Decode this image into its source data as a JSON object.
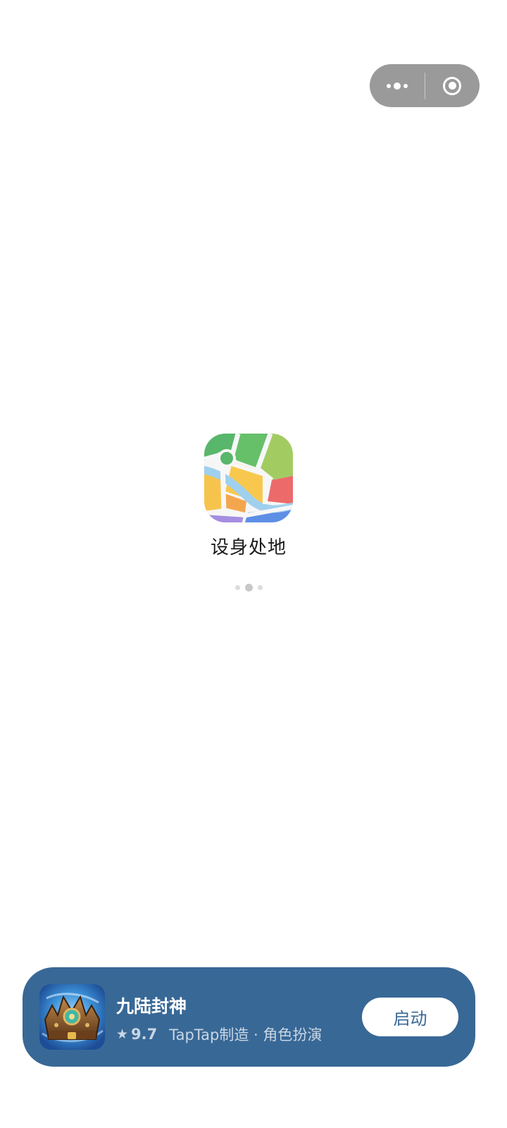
{
  "capsule": {
    "more_icon": "more-dots-icon",
    "close_icon": "close-circle-icon"
  },
  "splash": {
    "app_name": "设身处地",
    "logo_icon": "map-icon"
  },
  "banner": {
    "game_name": "九陆封神",
    "rating": "9.7",
    "meta": "TapTap制造 · 角色扮演",
    "launch_label": "启动",
    "background_color": "#386896"
  }
}
